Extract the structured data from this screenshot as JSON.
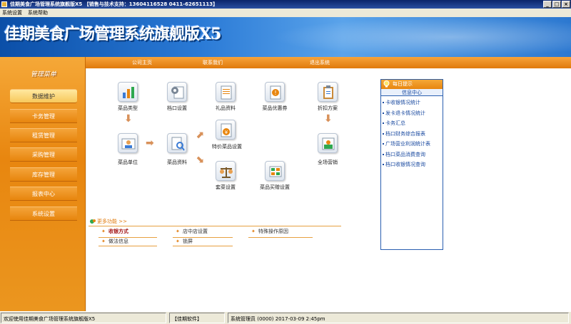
{
  "window": {
    "title": "佳期美食广场管理系统旗舰版X5 【销售与技术支持：13604116528  0411-62651113】",
    "buttons": [
      "_",
      "□",
      "×"
    ]
  },
  "menubar": {
    "items": [
      "系统设置",
      "系统帮助"
    ]
  },
  "banner": {
    "logo_text": "佳期美食广场管理系统旗舰版X5"
  },
  "topnav": {
    "items": [
      "公司主页",
      "联系我们",
      "退出系统"
    ]
  },
  "sidebar": {
    "heading": "管理菜单",
    "items": [
      {
        "label": "数据维护",
        "active": true
      },
      {
        "label": "卡务管理",
        "active": false
      },
      {
        "label": "租赁管理",
        "active": false
      },
      {
        "label": "采购管理",
        "active": false
      },
      {
        "label": "库存管理",
        "active": false
      },
      {
        "label": "报表中心",
        "active": false
      },
      {
        "label": "系统设置",
        "active": false
      }
    ]
  },
  "icons": {
    "dish_type": {
      "label": "菜品类型",
      "icon": "bar-chart-icon"
    },
    "stall_setup": {
      "label": "档口设置",
      "icon": "gear-document-icon"
    },
    "gift_data": {
      "label": "礼品资料",
      "icon": "document-icon"
    },
    "dish_coupon": {
      "label": "菜品优惠券",
      "icon": "coupon-icon"
    },
    "discount_plan": {
      "label": "折扣方案",
      "icon": "clipboard-icon"
    },
    "dish_unit": {
      "label": "菜品单位",
      "icon": "user-card-icon"
    },
    "dish_data": {
      "label": "菜品资料",
      "icon": "search-document-icon"
    },
    "special_dish": {
      "label": "特价菜品设置",
      "icon": "special-price-icon"
    },
    "set_meal": {
      "label": "套菜设置",
      "icon": "scale-icon"
    },
    "dish_buy_gift": {
      "label": "菜品买赠设置",
      "icon": "gift-grid-icon"
    },
    "site_promo": {
      "label": "全场营销",
      "icon": "promotion-icon"
    }
  },
  "daily_tips": {
    "title": "每日提示",
    "subtitle": "信息中心",
    "items": [
      "卡收银情况统计",
      "发卡退卡情况统计",
      "卡务汇总",
      "档口财务综合报表",
      "广场营业利润统计表",
      "档口菜品消费查询",
      "档口收银情况查询"
    ]
  },
  "more_functions": {
    "title": "更多功能 >>",
    "items": [
      {
        "label": "收银方式",
        "highlight": true
      },
      {
        "label": "店中店设置",
        "highlight": false
      },
      {
        "label": "特殊操作原因",
        "highlight": false
      },
      {
        "label": "做法信息",
        "highlight": false
      },
      {
        "label": "锁屏",
        "highlight": false
      }
    ]
  },
  "statusbar": {
    "welcome": "欢迎使用佳期美食广场管理系统旗舰版X5",
    "company": "【佳期软件】",
    "user_time": "系统管理员 (0000)  2017-03-09  2:45pm"
  },
  "colors": {
    "accent": "#e8860f",
    "banner_blue": "#2a7ad6",
    "link_blue": "#1a4aa0"
  }
}
